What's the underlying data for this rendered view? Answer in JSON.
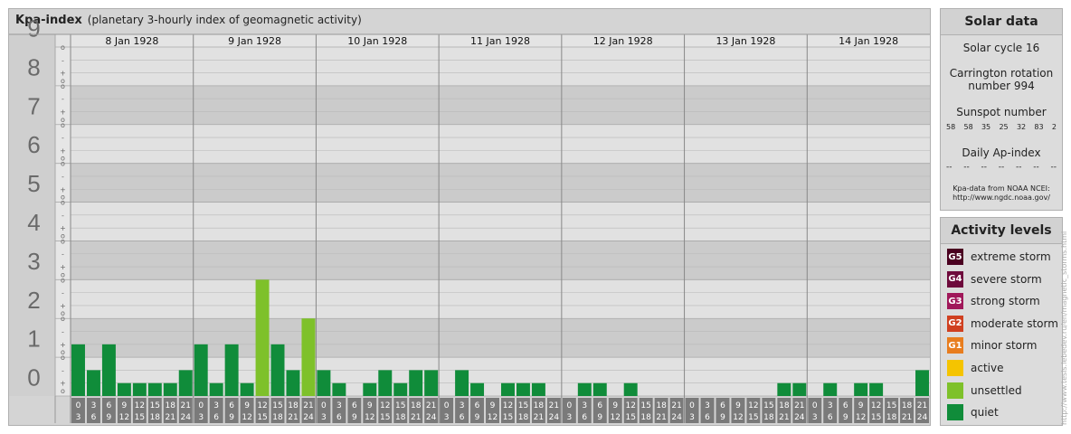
{
  "chart": {
    "title": "Kpa-index",
    "subtitle": "(planetary 3-hourly index of geomagnetic activity)"
  },
  "chart_data": {
    "type": "bar",
    "title": "Kpa-index",
    "subtitle": "(planetary 3-hourly index of geomagnetic activity)",
    "ylim": [
      0,
      9
    ],
    "y_ticks": [
      "0",
      "1",
      "2",
      "3",
      "4",
      "5",
      "6",
      "7",
      "8",
      "9"
    ],
    "sub_ticks": [
      "o",
      "+",
      "-",
      "o"
    ],
    "grid": true,
    "days": [
      "8 Jan 1928",
      "9 Jan 1928",
      "10 Jan 1928",
      "11 Jan 1928",
      "12 Jan 1928",
      "13 Jan 1928",
      "14 Jan 1928"
    ],
    "interval_top": [
      "0",
      "3",
      "6",
      "9",
      "12",
      "15",
      "18",
      "21"
    ],
    "interval_bottom": [
      "3",
      "6",
      "9",
      "12",
      "15",
      "18",
      "21",
      "24"
    ],
    "values": [
      [
        1.333,
        0.667,
        1.333,
        0.333,
        0.333,
        0.333,
        0.333,
        0.667
      ],
      [
        1.333,
        0.333,
        1.333,
        0.333,
        3.0,
        1.333,
        0.667,
        2.0
      ],
      [
        0.667,
        0.333,
        0.0,
        0.333,
        0.667,
        0.333,
        0.667,
        0.667
      ],
      [
        0.0,
        0.667,
        0.333,
        0.0,
        0.333,
        0.333,
        0.333,
        0.0
      ],
      [
        0.0,
        0.333,
        0.333,
        0.0,
        0.333,
        0.0,
        0.0,
        0.0
      ],
      [
        0.0,
        0.0,
        0.0,
        0.0,
        0.0,
        0.0,
        0.333,
        0.333
      ],
      [
        0.0,
        0.333,
        0.0,
        0.333,
        0.333,
        0.0,
        0.0,
        0.667
      ]
    ],
    "level_colors": {
      "quiet": "#108c3a",
      "unsettled": "#7ec12a",
      "active": "#f5c400",
      "minor_storm": "#e87d1e",
      "moderate_storm": "#d04020",
      "strong_storm": "#a0185a",
      "severe_storm": "#6e0a3c",
      "extreme_storm": "#4a0020"
    }
  },
  "solar": {
    "title": "Solar data",
    "cycle": "Solar cycle 16",
    "carrington_line1": "Carrington rotation",
    "carrington_line2": "number 994",
    "sunspot_title": "Sunspot number",
    "sunspots": [
      "58",
      "58",
      "35",
      "25",
      "32",
      "83",
      "2"
    ],
    "ap_title": "Daily Ap-index",
    "ap_values": [
      "--",
      "--",
      "--",
      "--",
      "--",
      "--",
      "--"
    ],
    "source_line1": "Kpa-data from NOAA NCEI:",
    "source_line2": "http://www.ngdc.noaa.gov/"
  },
  "activity": {
    "title": "Activity levels",
    "levels": [
      {
        "badge": "G5",
        "label": "extreme storm",
        "color": "#4a0020"
      },
      {
        "badge": "G4",
        "label": "severe storm",
        "color": "#6e0a3c"
      },
      {
        "badge": "G3",
        "label": "strong storm",
        "color": "#a0185a"
      },
      {
        "badge": "G2",
        "label": "moderate storm",
        "color": "#d04020"
      },
      {
        "badge": "G1",
        "label": "minor storm",
        "color": "#e87d1e"
      },
      {
        "badge": "",
        "label": "active",
        "color": "#f5c400"
      },
      {
        "badge": "",
        "label": "unsettled",
        "color": "#7ec12a"
      },
      {
        "badge": "",
        "label": "quiet",
        "color": "#108c3a"
      }
    ]
  },
  "watermark": "http://www.tesis.lebedev.ru/en/magnetic_storms.html"
}
